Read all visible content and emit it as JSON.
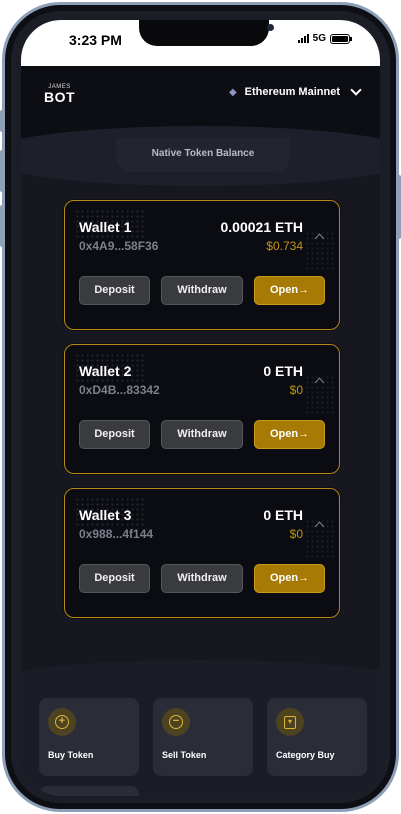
{
  "status": {
    "time": "3:23 PM",
    "network": "5G"
  },
  "header": {
    "logo_small": "JAMES",
    "logo_main": "BOT",
    "network_name": "Ethereum Mainnet"
  },
  "balance_tab": "Native Token Balance",
  "actions": {
    "deposit": "Deposit",
    "withdraw": "Withdraw",
    "open": "Open→"
  },
  "wallets": [
    {
      "name": "Wallet 1",
      "address": "0x4A9...58F36",
      "balance": "0.00021 ETH",
      "usd": "$0.734"
    },
    {
      "name": "Wallet 2",
      "address": "0xD4B...83342",
      "balance": "0 ETH",
      "usd": "$0"
    },
    {
      "name": "Wallet 3",
      "address": "0x988...4f144",
      "balance": "0 ETH",
      "usd": "$0"
    }
  ],
  "tiles": [
    {
      "label": "Buy Token",
      "icon": "plus-circle-icon"
    },
    {
      "label": "Sell Token",
      "icon": "minus-circle-icon"
    },
    {
      "label": "Category Buy",
      "icon": "bag-icon"
    }
  ],
  "colors": {
    "accent": "#a77a05",
    "border_gold": "#b58a14",
    "usd_gold": "#c4931a"
  }
}
